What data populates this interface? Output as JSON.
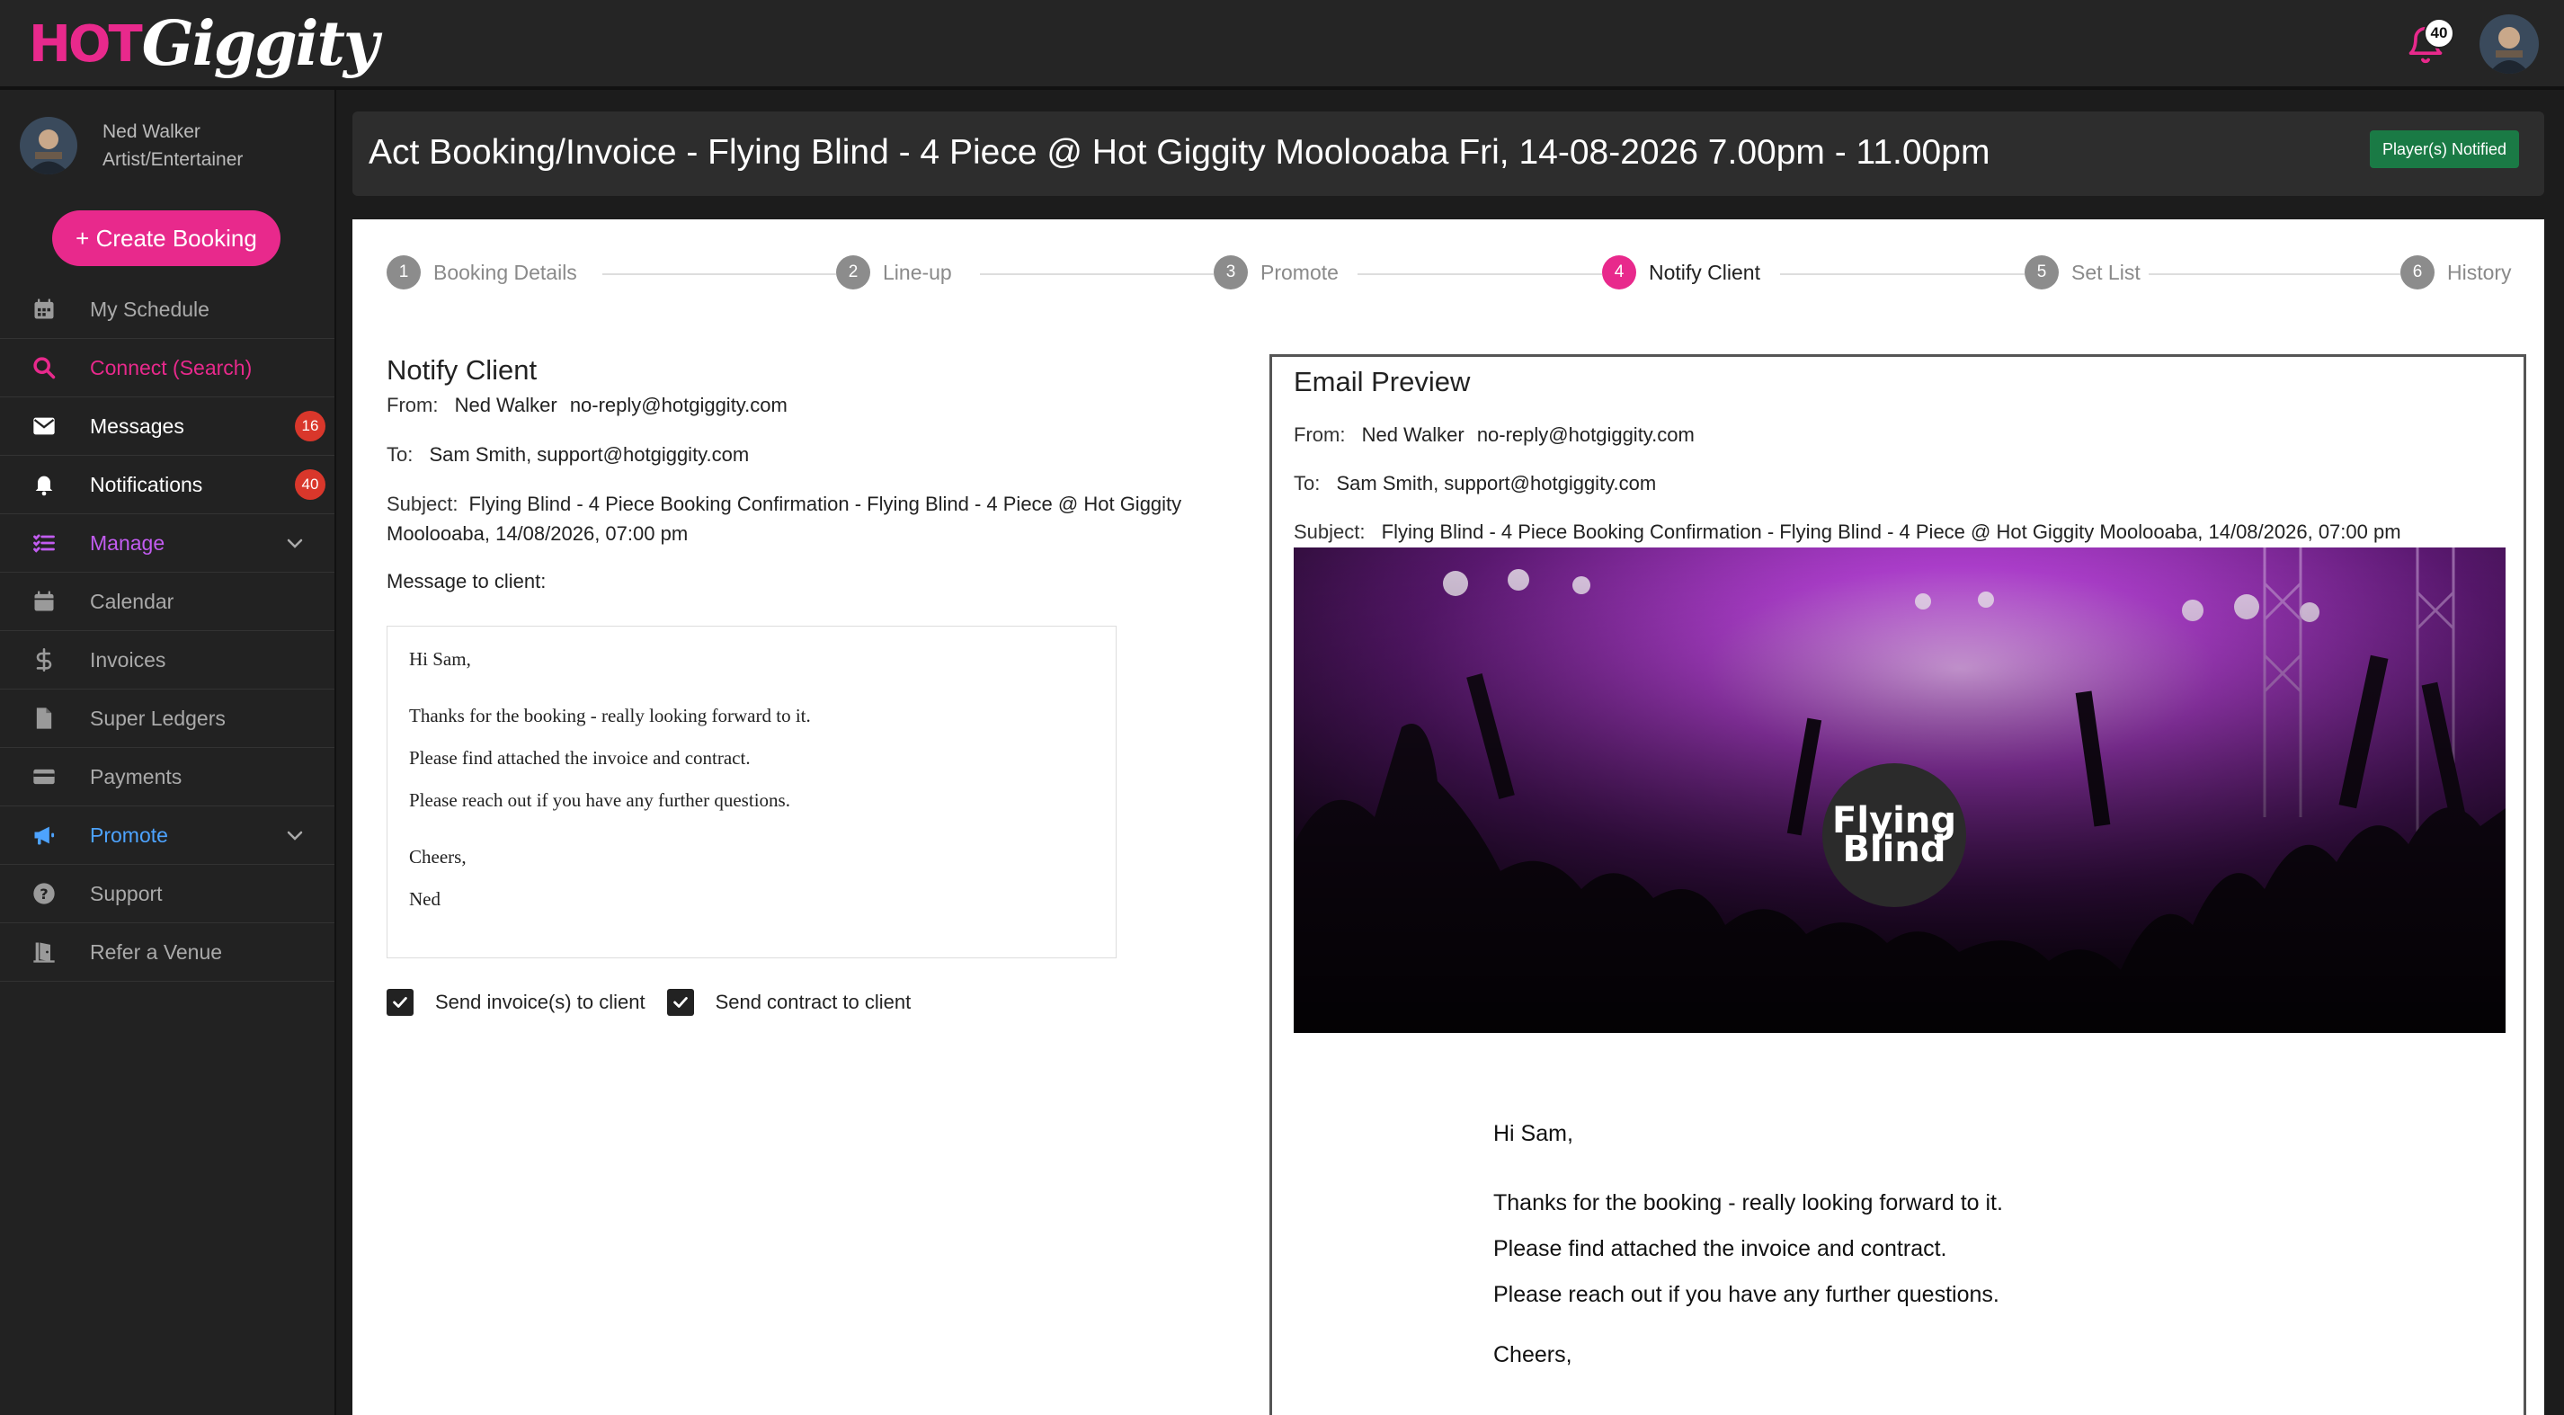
{
  "app": {
    "logo_hot": "HOT",
    "logo_giggity": "Giggity",
    "notification_count": "40"
  },
  "user": {
    "name": "Ned Walker",
    "role": "Artist/Entertainer"
  },
  "sidebar": {
    "create_button": "+ Create Booking",
    "items": [
      {
        "label": "My Schedule",
        "icon": "calendar-grid-icon",
        "style": "normal"
      },
      {
        "label": "Connect (Search)",
        "icon": "search-icon",
        "style": "pink"
      },
      {
        "label": "Messages",
        "icon": "envelope-icon",
        "style": "bright",
        "badge": "16"
      },
      {
        "label": "Notifications",
        "icon": "bell-icon",
        "style": "bright",
        "badge": "40"
      },
      {
        "label": "Manage",
        "icon": "list-check-icon",
        "style": "purple",
        "chevron": true
      },
      {
        "label": "Calendar",
        "icon": "calendar-icon",
        "style": "normal"
      },
      {
        "label": "Invoices",
        "icon": "dollar-icon",
        "style": "normal"
      },
      {
        "label": "Super Ledgers",
        "icon": "document-icon",
        "style": "normal"
      },
      {
        "label": "Payments",
        "icon": "credit-card-icon",
        "style": "normal"
      },
      {
        "label": "Promote",
        "icon": "megaphone-icon",
        "style": "blue",
        "chevron": true
      },
      {
        "label": "Support",
        "icon": "help-circle-icon",
        "style": "normal"
      },
      {
        "label": "Refer a Venue",
        "icon": "door-icon",
        "style": "normal"
      }
    ]
  },
  "header": {
    "title": "Act Booking/Invoice - Flying Blind - 4 Piece @ Hot Giggity Moolooaba Fri, 14-08-2026 7.00pm - 11.00pm",
    "status": "Player(s) Notified"
  },
  "steps": [
    {
      "num": "1",
      "label": "Booking Details"
    },
    {
      "num": "2",
      "label": "Line-up"
    },
    {
      "num": "3",
      "label": "Promote"
    },
    {
      "num": "4",
      "label": "Notify Client",
      "active": true
    },
    {
      "num": "5",
      "label": "Set List"
    },
    {
      "num": "6",
      "label": "History"
    }
  ],
  "notify": {
    "title": "Notify Client",
    "from_label": "From:",
    "from_name": "Ned Walker",
    "from_email": "no-reply@hotgiggity.com",
    "to_label": "To:",
    "to_value": "Sam Smith, support@hotgiggity.com",
    "subject_label": "Subject:",
    "subject_value": "Flying Blind - 4 Piece Booking Confirmation - Flying Blind - 4 Piece @ Hot Giggity Moolooaba, 14/08/2026, 07:00 pm",
    "message_label": "Message to client:",
    "message": {
      "greeting": "Hi Sam,",
      "line1": "Thanks for the booking - really looking forward to it.",
      "line2": "Please find attached the invoice and contract.",
      "line3": "Please reach out if you have any further questions.",
      "signoff": "Cheers,",
      "signature": "Ned"
    },
    "send_invoice_label": "Send invoice(s) to client",
    "send_invoice_checked": true,
    "send_contract_label": "Send contract to client",
    "send_contract_checked": true
  },
  "preview": {
    "title": "Email Preview",
    "from_label": "From:",
    "from_name": "Ned Walker",
    "from_email": "no-reply@hotgiggity.com",
    "to_label": "To:",
    "to_value": "Sam Smith, support@hotgiggity.com",
    "subject_label": "Subject:",
    "subject_value": "Flying Blind - 4 Piece Booking Confirmation - Flying Blind - 4 Piece @ Hot Giggity Moolooaba, 14/08/2026, 07:00 pm",
    "band_logo_line1": "Flying",
    "band_logo_line2": "Blind",
    "body": {
      "greeting": "Hi Sam,",
      "line1": "Thanks for the booking - really looking forward to it.",
      "line2": "Please find attached the invoice and contract.",
      "line3": "Please reach out if you have any further questions.",
      "signoff": "Cheers,"
    }
  },
  "colors": {
    "brand_pink": "#e8298c",
    "status_green": "#1a7a45",
    "badge_red": "#d9372b",
    "manage_purple": "#c25cf0",
    "promote_blue": "#4da3ff"
  }
}
